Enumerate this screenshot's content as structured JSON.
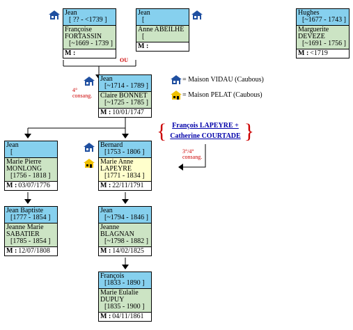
{
  "cards": {
    "c1": {
      "head_name": "Jean",
      "head_dates": "[ ?? - <1739 ]",
      "spouse_name": "Françoise FORTASSIN",
      "spouse_dates": "[~1669 - 1739 ]",
      "marriage": ""
    },
    "c2": {
      "head_name": "Jean",
      "head_dates": "[",
      "spouse_name": "Anne ABEILHÉ",
      "spouse_dates": "[",
      "marriage": ""
    },
    "c3": {
      "head_name": "Hughes",
      "head_dates": "[~1677 - 1743 ]",
      "spouse_name": "Marguerite DEVEZE",
      "spouse_dates": "[~1691 - 1756 ]",
      "marriage": "<1719"
    },
    "c4": {
      "head_name": "Jean",
      "head_dates": "[~1714 - 1789 ]",
      "spouse_name": "Claire BONNET",
      "spouse_dates": "[~1725 - 1785 ]",
      "marriage": "10/01/1747"
    },
    "c5": {
      "head_name": "Jean",
      "head_dates": "[",
      "spouse_name": "Marie Pierre MONLONG",
      "spouse_dates": "[1756 - 1818 ]",
      "marriage": "03/07/1776"
    },
    "c6": {
      "head_name": "Bernard",
      "head_dates": "[1753 - 1806 ]",
      "spouse_name": "Marie Anne LAPEYRE",
      "spouse_dates": "[1771 - 1834 ]",
      "marriage": "22/11/1791"
    },
    "c7": {
      "head_name": "Jean Baptiste",
      "head_dates": "[1777 - 1854 ]",
      "spouse_name": "Jeanne Marie SABATIER",
      "spouse_dates": "[1785 - 1854 ]",
      "marriage": "12/07/1808"
    },
    "c8": {
      "head_name": "Jean",
      "head_dates": "[~1794 - 1846 ]",
      "spouse_name": "Jeanne BLAGNAN",
      "spouse_dates": "[~1798 - 1882 ]",
      "marriage": "14/02/1825"
    },
    "c9": {
      "head_name": "François",
      "head_dates": "[1833 - 1890 ]",
      "spouse_name": "Marie Eulalie DUPUY",
      "spouse_dates": "[1835 - 1900 ]",
      "marriage": "04/11/1861"
    }
  },
  "marriage_label": "M :",
  "ou_label": "OU",
  "consang_4": "4° consang.",
  "consang_34": "3°/4° consang.",
  "legend": {
    "vidau": "= Maison VIDAU (Caubous)",
    "pelat": "= Maison PELAT (Caubous)"
  },
  "link_couple": {
    "line1": "François LAPEYRE +",
    "line2": "Catherine COURTADE"
  },
  "colors": {
    "head": "#86d0ee",
    "spouse": "#cce4c4",
    "spouse_alt": "#ffffcc",
    "consang": "#cc0000",
    "link": "#0000aa",
    "house_blue": "#1f4fa0",
    "house_yellow": "#f0c000"
  },
  "icons": [
    "house-vidau-icon",
    "house-pelat-icon"
  ]
}
